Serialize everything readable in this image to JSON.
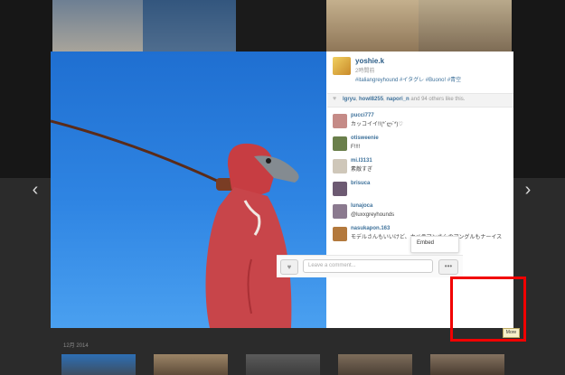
{
  "post": {
    "username": "yoshie.k",
    "time": "2時間前",
    "hashtags": "#italiangreyhound #イタグレ #Buono! #青空"
  },
  "likes": {
    "users": [
      "lgryu",
      "howl8255",
      "napori_n"
    ],
    "count_text": "and 94 others like this."
  },
  "comments": [
    {
      "user": "pucci777",
      "text": "カッコイイ!!(*´ლ`*)♡"
    },
    {
      "user": "otisweenie",
      "text": "F!!!!"
    },
    {
      "user": "mi.l3131",
      "text": "素敵すぎ"
    },
    {
      "user": "brisuca",
      "text": ""
    },
    {
      "user": "lunajoca",
      "text": "@luxxgreyhounds"
    },
    {
      "user": "nasukapon.163",
      "text": "モデルさんもいいけど、カメラマンさんのアングルもナーイス"
    }
  ],
  "footer": {
    "comment_placeholder": "Leave a comment...",
    "more_label": "•••"
  },
  "menu": {
    "embed_label": "Embed"
  },
  "tooltip": "More",
  "nav": {
    "prev": "‹",
    "next": "›"
  },
  "grid": {
    "date": "12月 2014"
  },
  "colors": {
    "link": "#3f729b",
    "highlight": "#f10000",
    "sky": "#2f85e3"
  }
}
